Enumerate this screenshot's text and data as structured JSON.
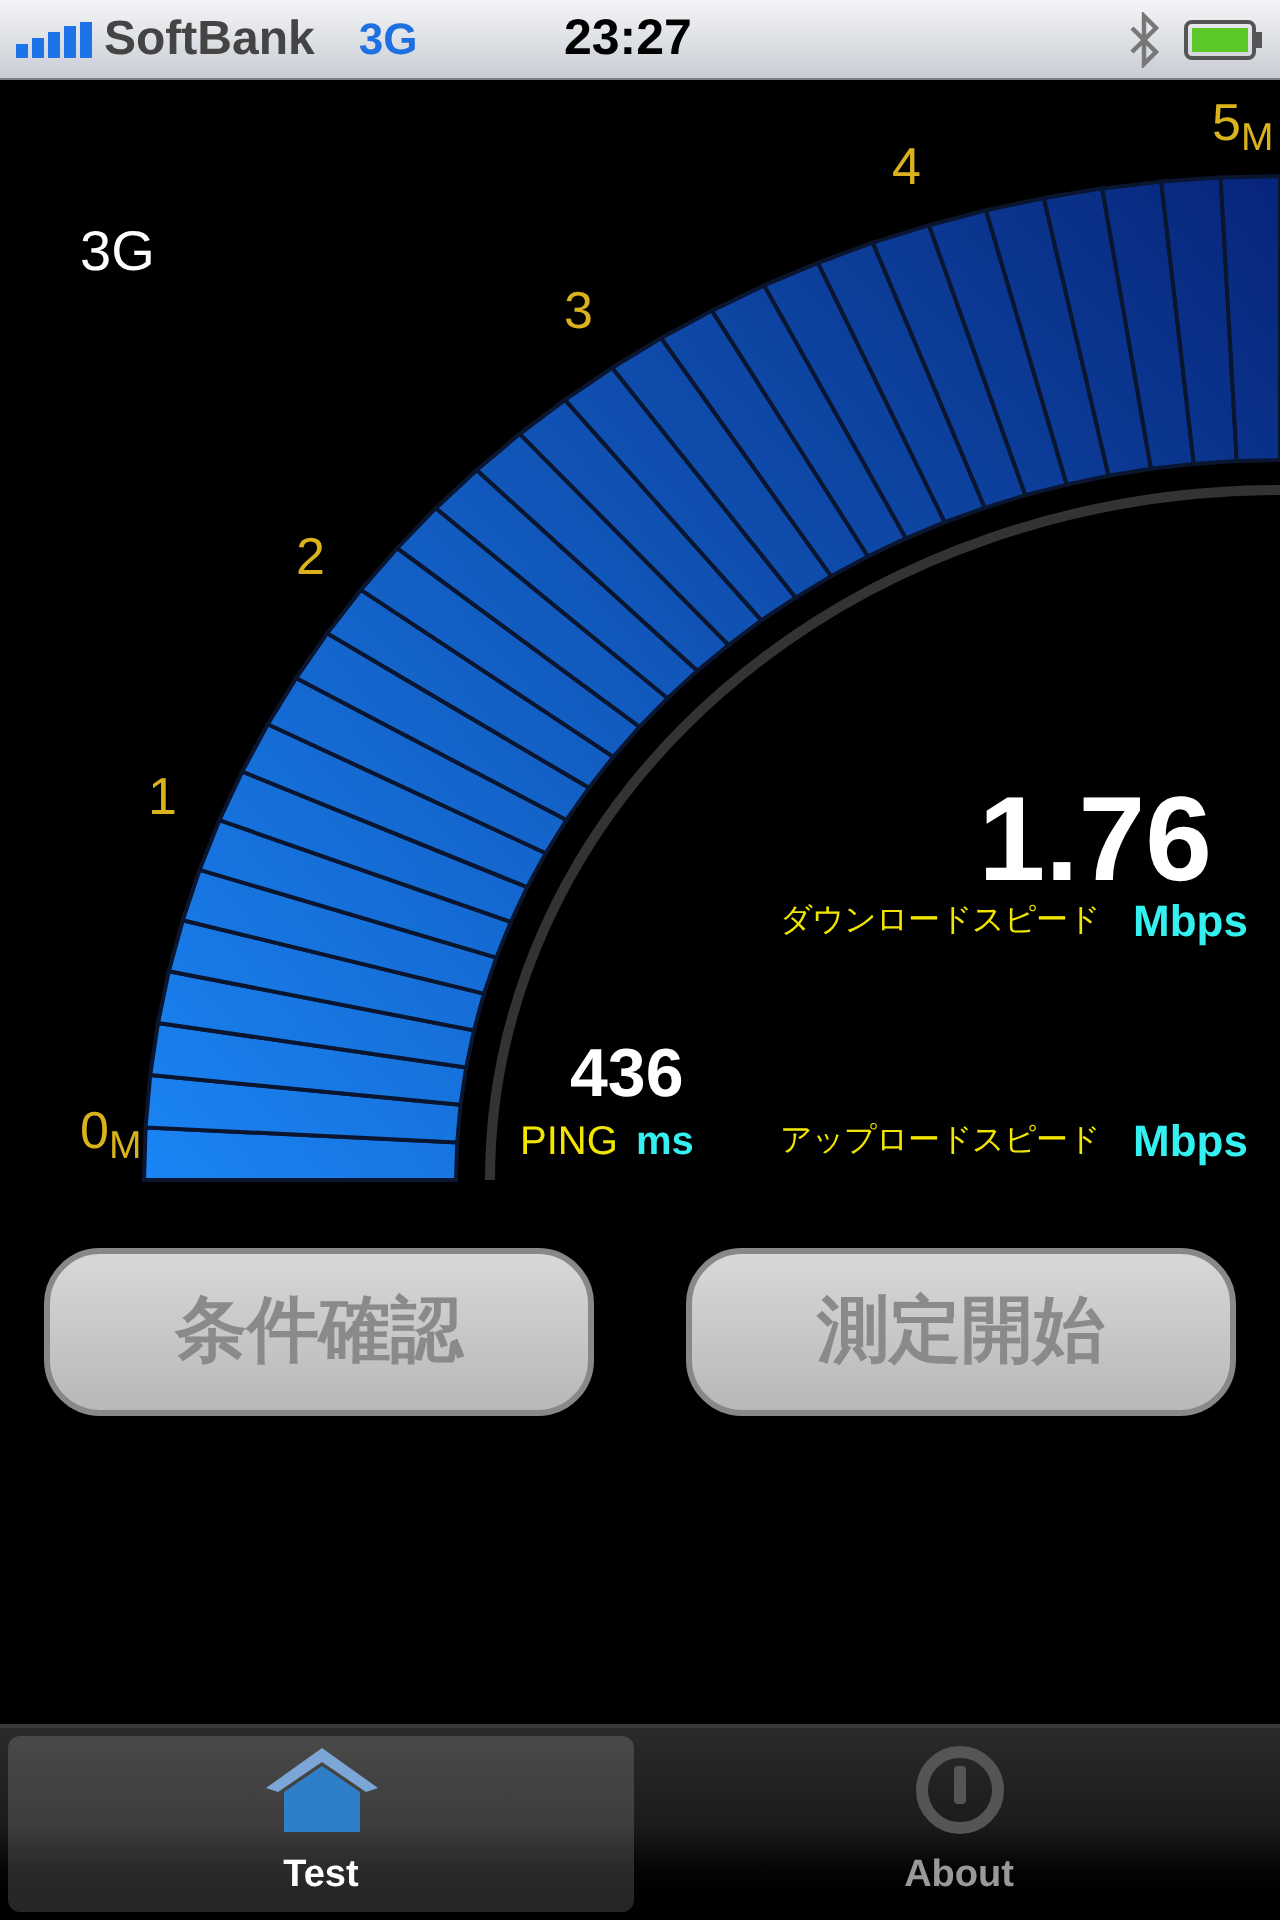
{
  "status_bar": {
    "carrier": "SoftBank",
    "network": "3G",
    "time": "23:27"
  },
  "network_type": "3G",
  "gauge": {
    "ticks": [
      "0$_{M}$",
      "1",
      "2",
      "3",
      "4",
      "5$_{M}$"
    ]
  },
  "download": {
    "value": "1.76",
    "label": "ダウンロードスピード",
    "unit": "Mbps"
  },
  "ping": {
    "value": "436",
    "label": "PING",
    "unit": "ms"
  },
  "upload": {
    "label": "アップロードスピード",
    "unit": "Mbps"
  },
  "buttons": [
    {
      "label": "条件確認",
      "disabled": true
    },
    {
      "label": "測定開始",
      "disabled": true
    }
  ],
  "tabs": [
    {
      "label": "Test",
      "kind": "house",
      "selected": true
    },
    {
      "label": "About",
      "kind": "info",
      "selected": false
    }
  ]
}
